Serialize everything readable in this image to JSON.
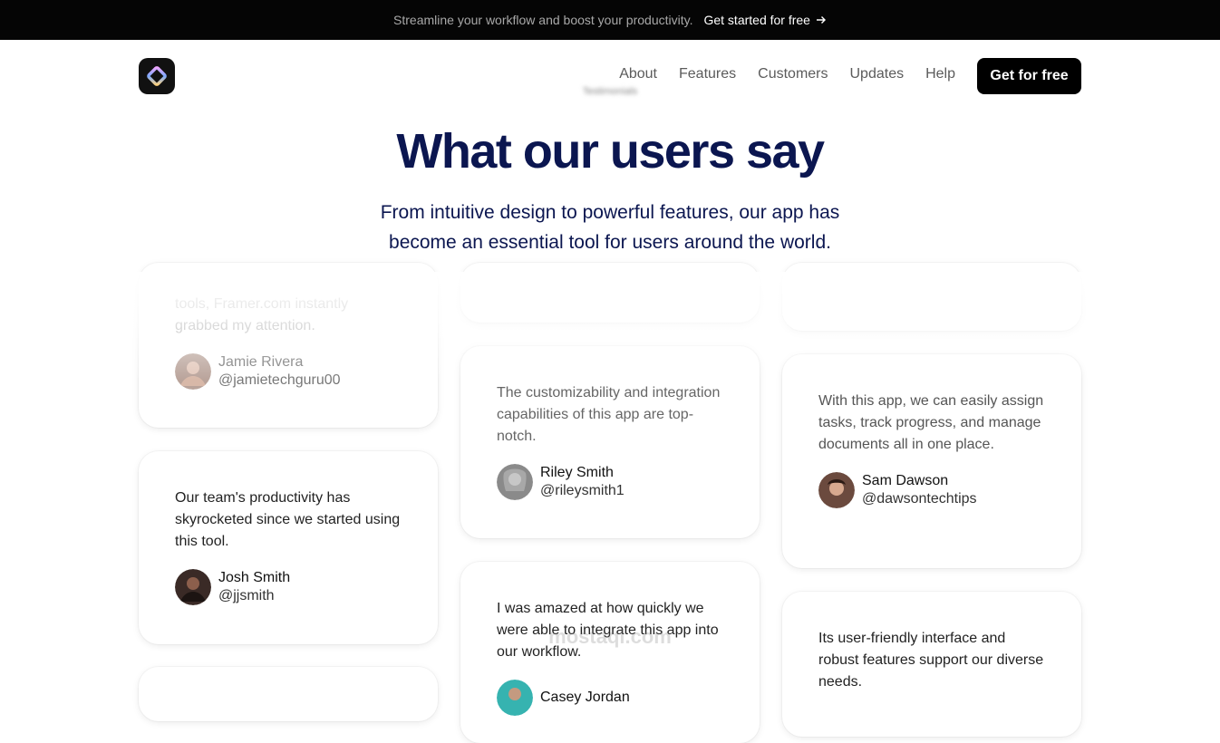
{
  "topbar": {
    "message": "Streamline your workflow and boost your productivity.",
    "cta_label": "Get started for free",
    "cta_icon": "arrow-right-icon"
  },
  "nav": {
    "logo_icon": "app-logo-icon",
    "links": [
      "About",
      "Features",
      "Customers",
      "Updates",
      "Help"
    ],
    "button_label": "Get for free"
  },
  "hero": {
    "eyebrow": "Testimonials",
    "title": "What our users say",
    "subtitle": "From intuitive design to powerful features, our app has become an essential tool for users around the world."
  },
  "testimonials": {
    "col1": [
      {
        "quote": "tools, Framer.com instantly grabbed my attention.",
        "name": "Jamie Rivera",
        "handle": "@jamietechguru00",
        "avatar_color": "#b9a39a"
      },
      {
        "quote": "Our team's productivity has skyrocketed since we started using this tool.",
        "name": "Josh Smith",
        "handle": "@jjsmith",
        "avatar_color": "#3a2a26"
      }
    ],
    "col2": [
      {
        "quote": "The customizability and integration capabilities of this app are top-notch.",
        "name": "Riley Smith",
        "handle": "@rileysmith1",
        "avatar_color": "#8a8a8a"
      },
      {
        "quote": "I was amazed at how quickly we were able to integrate this app into our workflow.",
        "name": "Casey Jordan",
        "handle": "",
        "avatar_color": "#36b3b0"
      }
    ],
    "col3": [
      {
        "quote": "With this app, we can easily assign tasks, track progress, and manage documents all in one place.",
        "name": "Sam Dawson",
        "handle": "@dawsontechtips",
        "avatar_color": "#6b4a3e"
      },
      {
        "quote": "Its user-friendly interface and robust features support our diverse needs.",
        "name": "",
        "handle": "",
        "avatar_color": "#cccccc"
      }
    ]
  },
  "watermark": "mostaql.com",
  "colors": {
    "accent": "#0b1650",
    "topbar_bg": "#050505",
    "button_bg": "#000000"
  }
}
